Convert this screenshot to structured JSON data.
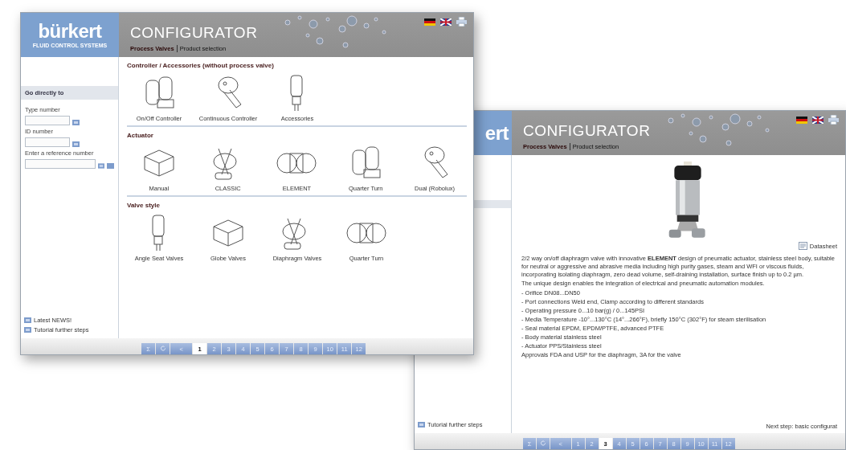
{
  "windows": [
    {
      "kind": "selection",
      "logo": "bürkert",
      "tagline": "FLUID CONTROL SYSTEMS",
      "title": "CONFIGURATOR",
      "breadcrumb": {
        "section": "Process Valves",
        "page": "Product selection"
      },
      "sidebar": {
        "heading": "Go directly to",
        "fields": [
          {
            "label": "Type number",
            "extra_button": false
          },
          {
            "label": "ID number",
            "extra_button": false
          },
          {
            "label": "Enter a reference number",
            "extra_button": true
          }
        ],
        "links": [
          "Latest NEWS!",
          "Tutorial further steps"
        ]
      },
      "sections": [
        {
          "heading": "Controller / Accessories (without process valve)",
          "items": [
            "On/Off Controller",
            "Continuous Controller",
            "Accessories"
          ]
        },
        {
          "heading": "Actuator",
          "items": [
            "Manual",
            "CLASSIC",
            "ELEMENT",
            "Quarter Turn",
            "Dual (Robolux)"
          ]
        },
        {
          "heading": "Valve style",
          "items": [
            "Angle Seat Valves",
            "Globe Valves",
            "Diaphragm Valves",
            "Quarter Turn"
          ]
        }
      ],
      "pagination": {
        "sum": "Σ",
        "prev": "<",
        "pages": [
          {
            "label": "1",
            "selected": true
          },
          {
            "label": "2",
            "selected": false
          },
          {
            "label": "3",
            "selected": false
          },
          {
            "label": "4",
            "selected": false
          },
          {
            "label": "5",
            "selected": false
          },
          {
            "label": "6",
            "selected": false
          },
          {
            "label": "7",
            "selected": false
          },
          {
            "label": "8",
            "selected": false
          },
          {
            "label": "9",
            "selected": false
          },
          {
            "label": "10",
            "selected": false
          },
          {
            "label": "11",
            "selected": false
          },
          {
            "label": "12",
            "selected": false
          }
        ]
      }
    },
    {
      "kind": "product",
      "logo": "ert",
      "title": "CONFIGURATOR",
      "breadcrumb": {
        "section": "Process Valves",
        "page": "Product selection"
      },
      "sidebar": {
        "links": [
          "Tutorial further steps"
        ]
      },
      "datasheet": "Datasheet",
      "description": [
        "2/2 way on/off diaphragm valve with innovative **ELEMENT** design of pneumatic actuator, stainless steel body, suitable for neutral or aggressive and abrasive media including high purity gases, steam and WFI or viscous fluids, incorporating isolating diaphragm, zero dead volume, self-draining installation, surface finish up to 0.2 µm.",
        "The unique design enables the integration of electrical and pneumatic automation modules.",
        "- Orifice DN08...DN50",
        "- Port connections Weld end, Clamp according to different standards",
        "- Operating pressure 0...10 bar(g) / 0...145PSI",
        "- Media Temperature -10°...130°C (14°...266°F), briefly 150°C (302°F) for steam sterilisation",
        "- Seal material EPDM, EPDM/PTFE, advanced PTFE",
        "- Body material stainless steel",
        "- Actuator PPS/Stainless steel",
        "Approvals FDA and USP for the diaphragm, 3A for the valve"
      ],
      "next_step": "Next step: basic configurat",
      "pagination": {
        "sum": "Σ",
        "prev": "<",
        "pages": [
          {
            "label": "1",
            "selected": false
          },
          {
            "label": "2",
            "selected": false
          },
          {
            "label": "3",
            "selected": true
          },
          {
            "label": "4",
            "selected": false
          },
          {
            "label": "5",
            "selected": false
          },
          {
            "label": "6",
            "selected": false
          },
          {
            "label": "7",
            "selected": false
          },
          {
            "label": "8",
            "selected": false
          },
          {
            "label": "9",
            "selected": false
          },
          {
            "label": "10",
            "selected": false
          },
          {
            "label": "11",
            "selected": false
          },
          {
            "label": "12",
            "selected": false
          }
        ]
      }
    }
  ]
}
